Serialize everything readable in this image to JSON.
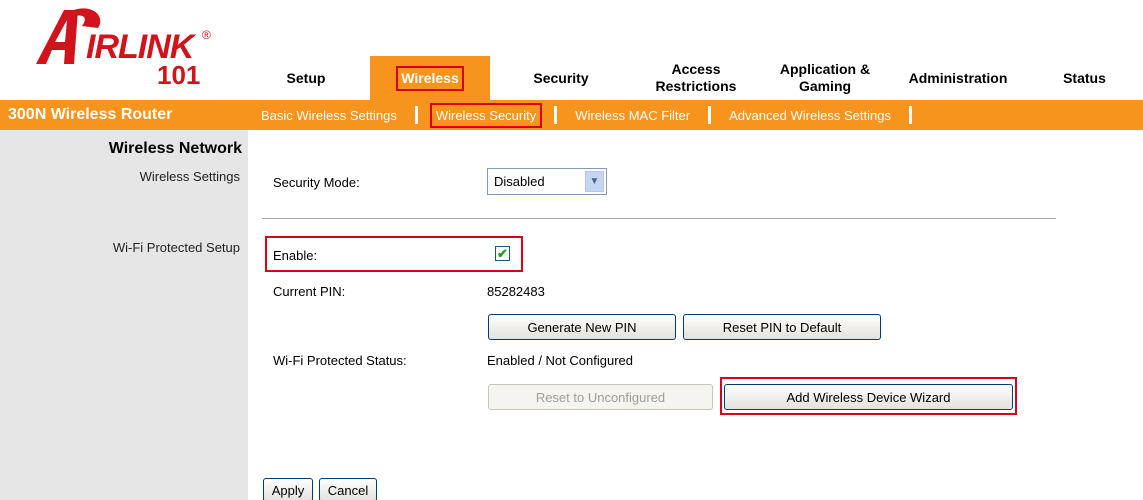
{
  "logo": {
    "brand": "IRLINK",
    "reg": "®",
    "number": "101"
  },
  "nav": {
    "tabs": [
      {
        "label": "Setup",
        "active": false
      },
      {
        "label": "Wireless",
        "active": true
      },
      {
        "label": "Security",
        "active": false
      },
      {
        "label": "Access Restrictions",
        "active": false
      },
      {
        "label": "Application & Gaming",
        "active": false
      },
      {
        "label": "Administration",
        "active": false
      },
      {
        "label": "Status",
        "active": false
      }
    ]
  },
  "subnav": {
    "router_title": "300N Wireless Router",
    "tabs": [
      {
        "label": "Basic Wireless Settings",
        "active": false
      },
      {
        "label": "Wireless Security",
        "active": true
      },
      {
        "label": "Wireless MAC Filter",
        "active": false
      },
      {
        "label": "Advanced Wireless Settings",
        "active": false
      }
    ]
  },
  "left": {
    "section_title": "Wireless Network",
    "wireless_settings": "Wireless Settings",
    "wps": "Wi-Fi Protected Setup"
  },
  "form": {
    "security_mode_label": "Security Mode:",
    "security_mode_value": "Disabled",
    "enable_label": "Enable:",
    "enable_checked": true,
    "current_pin_label": "Current PIN:",
    "current_pin_value": "85282483",
    "generate_pin": "Generate New PIN",
    "reset_pin": "Reset PIN to Default",
    "wps_status_label": "Wi-Fi Protected Status:",
    "wps_status_value": "Enabled / Not Configured",
    "reset_unconfigured": "Reset to Unconfigured",
    "add_wizard": "Add Wireless Device Wizard",
    "apply": "Apply",
    "cancel": "Cancel"
  },
  "colors": {
    "accent": "#f7941d",
    "highlight": "#d6001c",
    "brand": "#d1141b",
    "left_pane": "#e6e6e6"
  }
}
